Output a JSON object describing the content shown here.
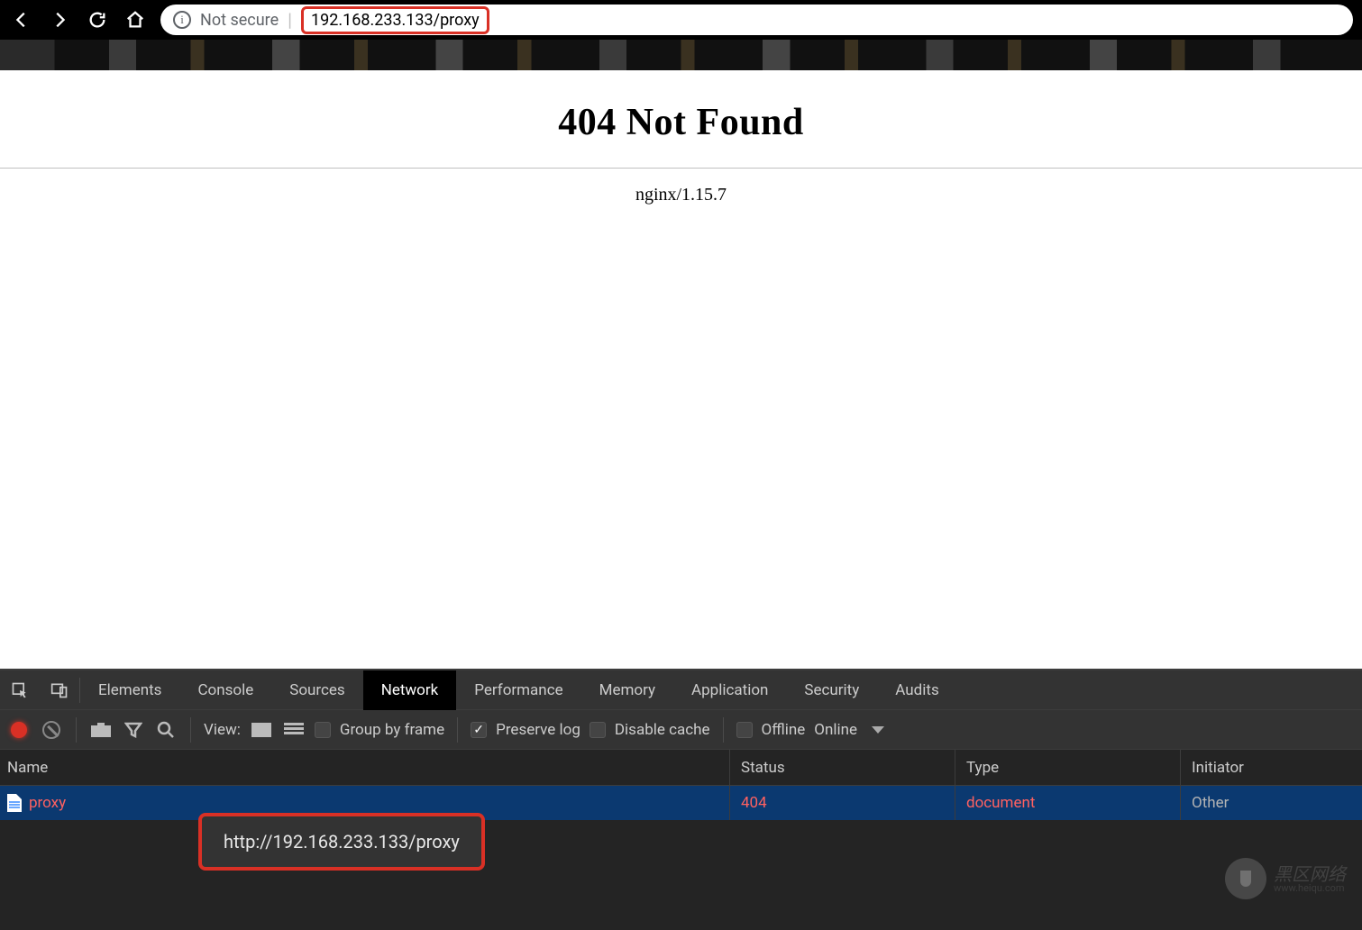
{
  "browser": {
    "not_secure_label": "Not secure",
    "url_display": "192.168.233.133/proxy"
  },
  "page": {
    "title": "404 Not Found",
    "server_line": "nginx/1.15.7"
  },
  "devtools": {
    "tabs": {
      "elements": "Elements",
      "console": "Console",
      "sources": "Sources",
      "network": "Network",
      "performance": "Performance",
      "memory": "Memory",
      "application": "Application",
      "security": "Security",
      "audits": "Audits"
    },
    "toolbar": {
      "view_label": "View:",
      "group_by_frame": "Group by frame",
      "preserve_log": "Preserve log",
      "disable_cache": "Disable cache",
      "offline": "Offline",
      "online": "Online"
    },
    "columns": {
      "name": "Name",
      "status": "Status",
      "type": "Type",
      "initiator": "Initiator"
    },
    "rows": [
      {
        "name": "proxy",
        "status": "404",
        "type": "document",
        "initiator": "Other"
      }
    ],
    "tooltip_url": "http://192.168.233.133/proxy"
  },
  "watermark": {
    "main": "黑区网络",
    "sub": "www.heiqu.com"
  }
}
